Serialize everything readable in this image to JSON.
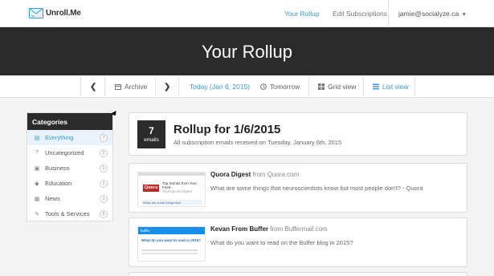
{
  "header": {
    "logo_text": "Unroll.Me",
    "nav": {
      "rollup": "Your Rollup",
      "subscriptions": "Edit Subscriptions"
    },
    "user_email": "jamie@socialyze.ca",
    "user_caret": "▼"
  },
  "hero": {
    "title": "Your Rollup"
  },
  "toolbar": {
    "prev_arrow": "❮",
    "archive": "Archive",
    "next_arrow": "❯",
    "today": "Today (Jan 6, 2015)",
    "tomorrow": "Tomorrow",
    "grid_view": "Grid view",
    "list_view": "List view"
  },
  "sidebar": {
    "heading": "Categories",
    "items": [
      {
        "label": "Everything",
        "count": "7",
        "icon": "inbox-icon"
      },
      {
        "label": "Uncategorized",
        "count": "2",
        "icon": "question-icon"
      },
      {
        "label": "Business",
        "count": "1",
        "icon": "briefcase-icon"
      },
      {
        "label": "Education",
        "count": "1",
        "icon": "graduation-cap-icon"
      },
      {
        "label": "News",
        "count": "1",
        "icon": "newspaper-icon"
      },
      {
        "label": "Tools & Services",
        "count": "5",
        "icon": "wrench-icon"
      }
    ]
  },
  "rollup": {
    "count": "7",
    "count_label": "emails",
    "title": "Rollup for 1/6/2015",
    "subtitle": "All subscription emails received on Tuesday, January 6th, 2015"
  },
  "emails": [
    {
      "sender": "Quora Digest",
      "from_word": "from",
      "domain": "Quora.com",
      "subject": "What are some things that neuroscientists know but most people don't? - Quora",
      "thumb_logo": "Quora",
      "thumb_heading": "Top Stories from Your Feed",
      "thumb_sub": "Your Quora Digest",
      "thumb_bar": "What are some things that"
    },
    {
      "sender": "Kevan From Buffer",
      "from_word": "from",
      "domain": "Buffermail.com",
      "subject": "What do you want to read on the Buffer blog in 2015?",
      "thumb_logo": "buffer",
      "thumb_heading": "What do you want to read in 2015?"
    }
  ],
  "colors": {
    "accent": "#3a9ad9",
    "dark": "#2b2b2b",
    "background": "#f4f4f4"
  }
}
